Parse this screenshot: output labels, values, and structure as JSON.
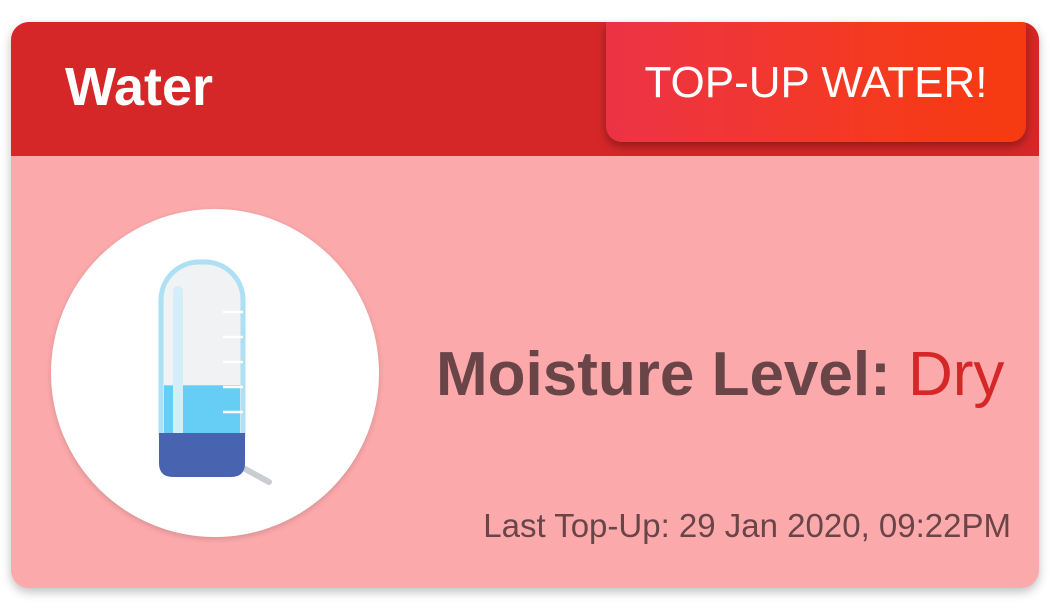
{
  "card": {
    "title": "Water",
    "action_button_label": "TOP-UP WATER!",
    "icon": "water-bottle-icon",
    "moisture_label": "Moisture Level:",
    "moisture_value": "Dry",
    "water_fill_level": 0.35,
    "last_topup_text": "Last Top-Up: 29 Jan 2020, 09:22PM"
  },
  "colors": {
    "header_bg": "#d62728",
    "card_bg": "#fba9ab",
    "label_text": "#6a4548",
    "status_dry": "#d62728",
    "button_gradient_start": "#ec3346",
    "button_gradient_end": "#f63a10"
  }
}
